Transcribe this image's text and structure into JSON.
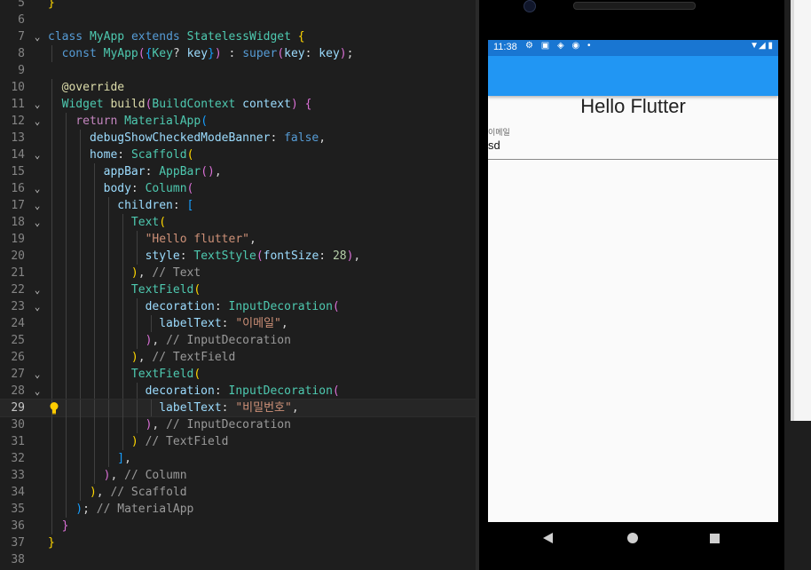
{
  "editor": {
    "lines": [
      {
        "n": "5",
        "fold": "",
        "tokens": [
          [
            "b1",
            "}"
          ]
        ]
      },
      {
        "n": "6",
        "fold": "",
        "tokens": []
      },
      {
        "n": "7",
        "fold": "⌄",
        "tokens": [
          [
            "kw",
            "class "
          ],
          [
            "ty",
            "MyApp "
          ],
          [
            "kw",
            "extends "
          ],
          [
            "ty",
            "StatelessWidget "
          ],
          [
            "b1",
            "{"
          ]
        ]
      },
      {
        "n": "8",
        "fold": "",
        "tokens": [
          [
            "kw",
            "  const "
          ],
          [
            "ty",
            "MyApp"
          ],
          [
            "b2",
            "("
          ],
          [
            "b3",
            "{"
          ],
          [
            "ty",
            "Key"
          ],
          [
            "pl",
            "? "
          ],
          [
            "pr",
            "key"
          ],
          [
            "b3",
            "}"
          ],
          [
            "b2",
            ")"
          ],
          [
            "pl",
            " : "
          ],
          [
            "kw",
            "super"
          ],
          [
            "b2",
            "("
          ],
          [
            "pr",
            "key"
          ],
          [
            "pl",
            ": "
          ],
          [
            "pr",
            "key"
          ],
          [
            "b2",
            ")"
          ],
          [
            "pl",
            ";"
          ]
        ]
      },
      {
        "n": "9",
        "fold": "",
        "tokens": []
      },
      {
        "n": "10",
        "fold": "",
        "tokens": [
          [
            "pl",
            "  "
          ],
          [
            "fn",
            "@override"
          ]
        ]
      },
      {
        "n": "11",
        "fold": "⌄",
        "tokens": [
          [
            "ty",
            "  Widget "
          ],
          [
            "fn",
            "build"
          ],
          [
            "b2",
            "("
          ],
          [
            "ty",
            "BuildContext "
          ],
          [
            "pr",
            "context"
          ],
          [
            "b2",
            ") "
          ],
          [
            "b2",
            "{"
          ]
        ]
      },
      {
        "n": "12",
        "fold": "⌄",
        "tokens": [
          [
            "kw2",
            "    return "
          ],
          [
            "ty",
            "MaterialApp"
          ],
          [
            "b3",
            "("
          ]
        ]
      },
      {
        "n": "13",
        "fold": "",
        "tokens": [
          [
            "pr",
            "      debugShowCheckedModeBanner"
          ],
          [
            "pl",
            ": "
          ],
          [
            "kw",
            "false"
          ],
          [
            "pl",
            ","
          ]
        ]
      },
      {
        "n": "14",
        "fold": "⌄",
        "tokens": [
          [
            "pr",
            "      home"
          ],
          [
            "pl",
            ": "
          ],
          [
            "ty",
            "Scaffold"
          ],
          [
            "b1",
            "("
          ]
        ]
      },
      {
        "n": "15",
        "fold": "",
        "tokens": [
          [
            "pr",
            "        appBar"
          ],
          [
            "pl",
            ": "
          ],
          [
            "ty",
            "AppBar"
          ],
          [
            "b2",
            "()"
          ],
          [
            "pl",
            ","
          ]
        ]
      },
      {
        "n": "16",
        "fold": "⌄",
        "tokens": [
          [
            "pr",
            "        body"
          ],
          [
            "pl",
            ": "
          ],
          [
            "ty",
            "Column"
          ],
          [
            "b2",
            "("
          ]
        ]
      },
      {
        "n": "17",
        "fold": "⌄",
        "tokens": [
          [
            "pr",
            "          children"
          ],
          [
            "pl",
            ": "
          ],
          [
            "b3",
            "["
          ]
        ]
      },
      {
        "n": "18",
        "fold": "⌄",
        "tokens": [
          [
            "ty",
            "            Text"
          ],
          [
            "b1",
            "("
          ]
        ]
      },
      {
        "n": "19",
        "fold": "",
        "tokens": [
          [
            "st",
            "              \"Hello flutter\""
          ],
          [
            "pl",
            ","
          ]
        ]
      },
      {
        "n": "20",
        "fold": "",
        "tokens": [
          [
            "pr",
            "              style"
          ],
          [
            "pl",
            ": "
          ],
          [
            "ty",
            "TextStyle"
          ],
          [
            "b2",
            "("
          ],
          [
            "pr",
            "fontSize"
          ],
          [
            "pl",
            ": "
          ],
          [
            "nu",
            "28"
          ],
          [
            "b2",
            ")"
          ],
          [
            "pl",
            ","
          ]
        ]
      },
      {
        "n": "21",
        "fold": "",
        "tokens": [
          [
            "b1",
            "            )"
          ],
          [
            "pl",
            ", "
          ],
          [
            "cm",
            "// Text"
          ]
        ]
      },
      {
        "n": "22",
        "fold": "⌄",
        "tokens": [
          [
            "ty",
            "            TextField"
          ],
          [
            "b1",
            "("
          ]
        ]
      },
      {
        "n": "23",
        "fold": "⌄",
        "tokens": [
          [
            "pr",
            "              decoration"
          ],
          [
            "pl",
            ": "
          ],
          [
            "ty",
            "InputDecoration"
          ],
          [
            "b2",
            "("
          ]
        ]
      },
      {
        "n": "24",
        "fold": "",
        "tokens": [
          [
            "pr",
            "                labelText"
          ],
          [
            "pl",
            ": "
          ],
          [
            "st",
            "\"이메일\""
          ],
          [
            "pl",
            ","
          ]
        ]
      },
      {
        "n": "25",
        "fold": "",
        "tokens": [
          [
            "b2",
            "              )"
          ],
          [
            "pl",
            ", "
          ],
          [
            "cm",
            "// InputDecoration"
          ]
        ]
      },
      {
        "n": "26",
        "fold": "",
        "tokens": [
          [
            "b1",
            "            )"
          ],
          [
            "pl",
            ", "
          ],
          [
            "cm",
            "// TextField"
          ]
        ]
      },
      {
        "n": "27",
        "fold": "⌄",
        "tokens": [
          [
            "ty",
            "            TextField"
          ],
          [
            "b1",
            "("
          ]
        ]
      },
      {
        "n": "28",
        "fold": "⌄",
        "tokens": [
          [
            "pr",
            "              decoration"
          ],
          [
            "pl",
            ": "
          ],
          [
            "ty",
            "InputDecoration"
          ],
          [
            "b2",
            "("
          ]
        ]
      },
      {
        "n": "29",
        "fold": "",
        "tokens": [
          [
            "pr",
            "                labelText"
          ],
          [
            "pl",
            ": "
          ],
          [
            "st",
            "\"비밀번호\""
          ],
          [
            "pl",
            ","
          ]
        ]
      },
      {
        "n": "30",
        "fold": "",
        "tokens": [
          [
            "b2",
            "              )"
          ],
          [
            "pl",
            ", "
          ],
          [
            "cm",
            "// InputDecoration"
          ]
        ]
      },
      {
        "n": "31",
        "fold": "",
        "tokens": [
          [
            "b1",
            "            ) "
          ],
          [
            "cm",
            "// TextField"
          ]
        ]
      },
      {
        "n": "32",
        "fold": "",
        "tokens": [
          [
            "b3",
            "          ]"
          ],
          [
            "pl",
            ","
          ]
        ]
      },
      {
        "n": "33",
        "fold": "",
        "tokens": [
          [
            "b2",
            "        )"
          ],
          [
            "pl",
            ", "
          ],
          [
            "cm",
            "// Column"
          ]
        ]
      },
      {
        "n": "34",
        "fold": "",
        "tokens": [
          [
            "b1",
            "      )"
          ],
          [
            "pl",
            ", "
          ],
          [
            "cm",
            "// Scaffold"
          ]
        ]
      },
      {
        "n": "35",
        "fold": "",
        "tokens": [
          [
            "b3",
            "    )"
          ],
          [
            "pl",
            "; "
          ],
          [
            "cm",
            "// MaterialApp"
          ]
        ]
      },
      {
        "n": "36",
        "fold": "",
        "tokens": [
          [
            "b2",
            "  }"
          ]
        ]
      },
      {
        "n": "37",
        "fold": "",
        "tokens": [
          [
            "b1",
            "}"
          ]
        ]
      },
      {
        "n": "38",
        "fold": "",
        "tokens": []
      }
    ],
    "current_line": "29",
    "colors": {
      "background": "#1e1e1e",
      "keyword": "#569cd6",
      "type": "#4ec9b0",
      "string": "#ce9178",
      "comment": "#9a9a9a"
    }
  },
  "phone": {
    "status_time": "11:38",
    "status_icons": "⚙ ▣ ◈ ◉ •",
    "status_right": "▼◢ ▮",
    "app_bar_color": "#2196f3",
    "hello_text": "Hello Flutter",
    "email_label": "이메일",
    "email_value": "sd",
    "nav": {
      "back_icon": "back-triangle-icon",
      "home_icon": "home-circle-icon",
      "recent_icon": "recent-square-icon"
    }
  }
}
